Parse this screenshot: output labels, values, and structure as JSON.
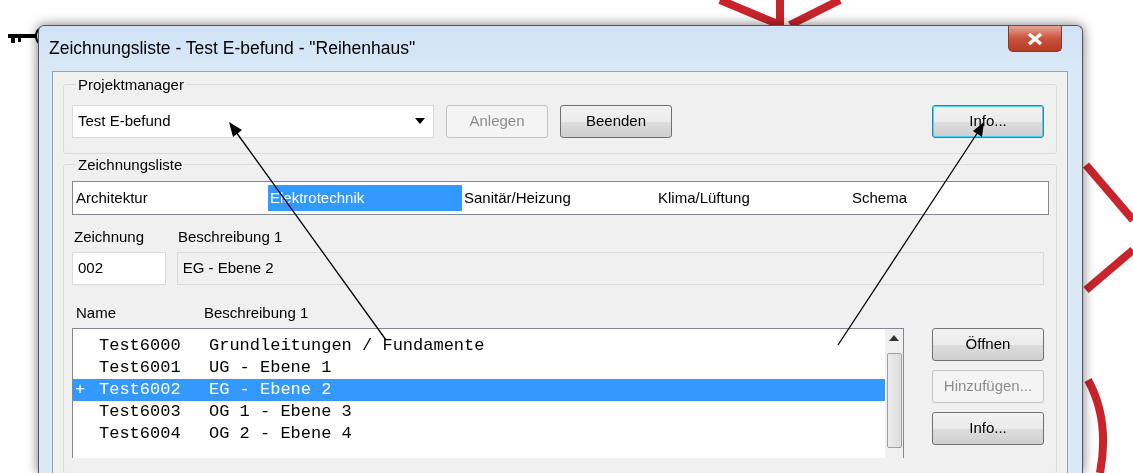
{
  "window": {
    "title": "Zeichnungsliste - Test E-befund - \"Reihenhaus\""
  },
  "projektmanager": {
    "label": "Projektmanager",
    "project": {
      "value": "Test E-befund"
    },
    "buttons": [
      {
        "label": "Anlegen",
        "disabled": true,
        "focused": false
      },
      {
        "label": "Beenden",
        "disabled": false,
        "focused": false
      },
      {
        "label": "Info...",
        "disabled": false,
        "focused": true
      }
    ]
  },
  "zeichnungsliste": {
    "label": "Zeichnungsliste",
    "disciplines": [
      {
        "label": "Architektur",
        "selected": false
      },
      {
        "label": "Elektrotechnik",
        "selected": true
      },
      {
        "label": "Sanitär/Heizung",
        "selected": false
      },
      {
        "label": "Klima/Lüftung",
        "selected": false
      },
      {
        "label": "Schema",
        "selected": false
      }
    ],
    "drawing_label": "Zeichnung",
    "description_label": "Beschreibung 1",
    "drawing_number": {
      "value": "002"
    },
    "description": {
      "value": "EG - Ebene 2",
      "disabled": true
    },
    "columns": [
      "Name",
      "Beschreibung 1"
    ],
    "rows": [
      {
        "name": "Test6000",
        "description": "Grundleitungen / Fundamente",
        "selected": false
      },
      {
        "name": "Test6001",
        "description": "UG - Ebene 1",
        "selected": false
      },
      {
        "marker": "+",
        "name": "Test6002",
        "description": "EG - Ebene 2",
        "selected": true
      },
      {
        "name": "Test6003",
        "description": "OG 1 - Ebene 3",
        "selected": false
      },
      {
        "name": "Test6004",
        "description": "OG 2 - Ebene 4",
        "selected": false
      }
    ],
    "buttons": [
      {
        "label": "Öffnen",
        "disabled": false
      },
      {
        "label": "Hinzufügen...",
        "disabled": true
      },
      {
        "label": "Info...",
        "disabled": false
      }
    ]
  }
}
